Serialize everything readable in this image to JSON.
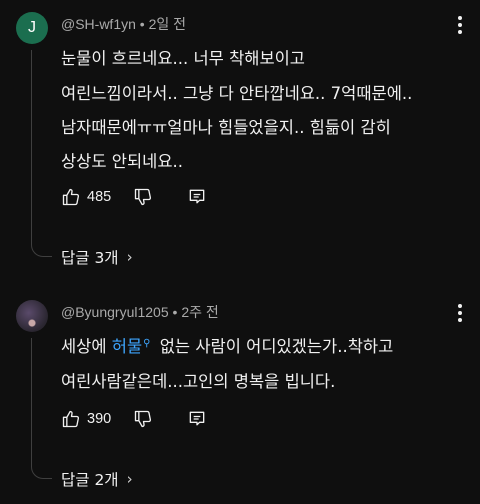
{
  "comments": [
    {
      "avatar_letter": "J",
      "author": "@SH-wf1yn",
      "time": "2일 전",
      "lines": [
        "눈물이 흐르네요... 너무 착해보이고",
        "여린느낌이라서.. 그냥 다 안타깝네요.. 7억때문에..",
        "남자때문에ㅠㅠ얼마나 힘들었을지.. 힘듦이 감히",
        "상상도 안되네요.."
      ],
      "likes": "485",
      "replies_label": "답글 3개"
    },
    {
      "author": "@Byungryul1205",
      "time": "2주 전",
      "line1_before": "세상에 ",
      "line1_link": "허물",
      "line1_after": " 없는 사람이 어디있겠는가..착하고",
      "line2": "여린사람같은데...고인의 명복을 빕니다.",
      "likes": "390",
      "replies_label": "답글 2개"
    }
  ],
  "separator": "•"
}
